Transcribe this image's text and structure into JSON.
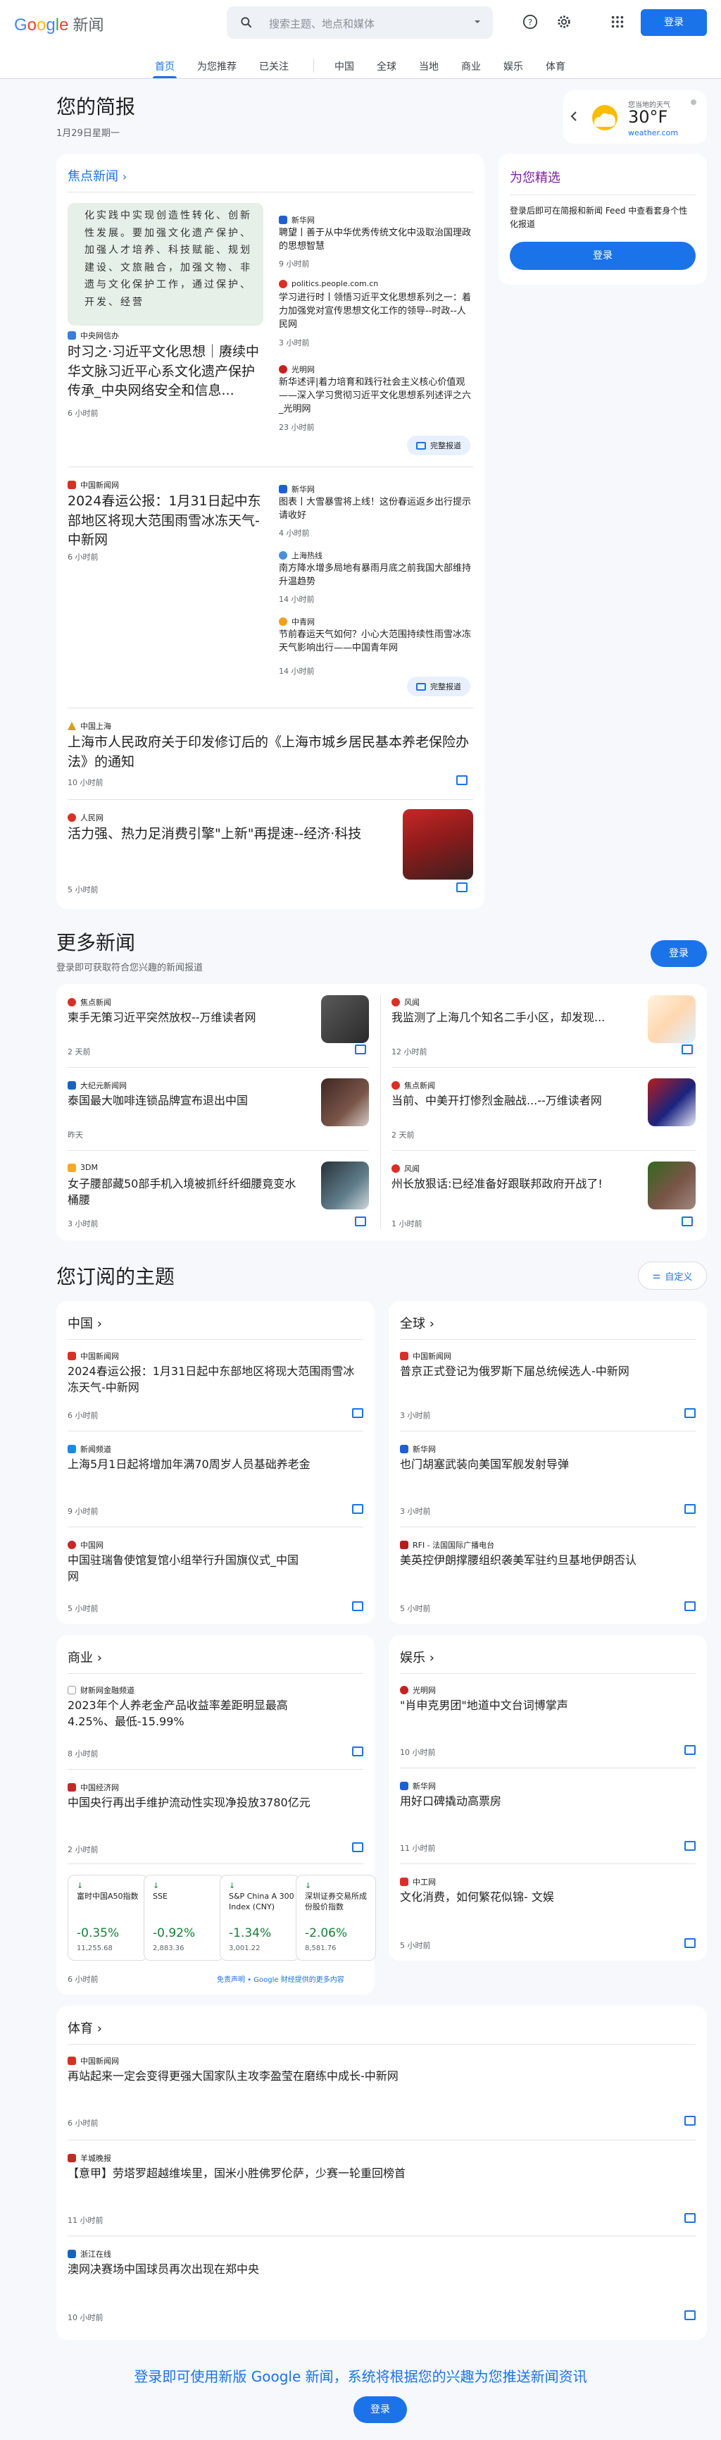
{
  "header": {
    "logo_google": "Google",
    "logo_news": "新闻",
    "search_placeholder": "搜索主题、地点和媒体",
    "signin": "登录"
  },
  "nav": {
    "items": [
      "首页",
      "为您推荐",
      "已关注",
      "中国",
      "全球",
      "当地",
      "商业",
      "娱乐",
      "体育"
    ]
  },
  "briefing": {
    "title": "您的简报",
    "date": "1月29日星期一"
  },
  "weather": {
    "label": "您当地的天气",
    "temp": "30°F",
    "source": "weather.com"
  },
  "foryou": {
    "title": "为您精选",
    "text": "登录后即可在简报和新闻 Feed 中查看套身个性化报道",
    "button": "登录"
  },
  "top": {
    "title": "焦点新闻",
    "c1": {
      "src": "中央网信办",
      "headline": "时习之·习近平文化思想｜赓续中华文脉习近平心系文化遗产保护传承_中央网络安全和信息...",
      "time": "6 小时前",
      "side": [
        {
          "src": "新华网",
          "t": "聘望丨善于从中华优秀传统文化中汲取治国理政的思想智慧",
          "tm": "9 小时前"
        },
        {
          "src": "politics.people.com.cn",
          "t": "学习进行时丨领悟习近平文化思想系列之一：着力加强党对宣传思想文化工作的领导--时政--人民网",
          "tm": "3 小时前"
        },
        {
          "src": "光明网",
          "t": "新华述评|着力培育和践行社会主义核心价值观——深入学习贯彻习近平文化思想系列述评之六_光明网",
          "tm": "23 小时前"
        }
      ],
      "full": "完整报道"
    },
    "c2": {
      "src": "中国新闻网",
      "headline": "2024春运公报：1月31日起中东部地区将现大范围雨雪冰冻天气-中新网",
      "time": "6 小时前",
      "side": [
        {
          "src": "新华网",
          "t": "图表丨大雪暴雪将上线！这份春运返乡出行提示请收好",
          "tm": "4 小时前"
        },
        {
          "src": "上海热线",
          "t": "南方降水增多局地有暴雨月底之前我国大部维持升温趋势",
          "tm": "14 小时前"
        },
        {
          "src": "中青网",
          "t": "节前春运天气如何？小心大范围持续性雨雪冰冻天气影响出行——中国青年网",
          "tm": "14 小时前"
        }
      ],
      "full": "完整报道"
    },
    "c3": {
      "src": "中国上海",
      "headline": "上海市人民政府关于印发修订后的《上海市城乡居民基本养老保险办法》的通知",
      "time": "10 小时前"
    },
    "c4": {
      "src": "人民网",
      "headline": "活力强、热力足消费引擎\"上新\"再提速--经济·科技",
      "time": "5 小时前"
    },
    "calligraphy": "化实践中实现创造性转化、创新性发展。要加强文化遗产保护、加强人才培养、科技赋能、规划建设、文旅融合，加强文物、非遗与文化保护工作，通过保护、开发、经营"
  },
  "more": {
    "title": "更多新闻",
    "sub": "登录即可获取符合您兴趣的新闻报道",
    "button": "登录",
    "items": [
      {
        "src": "焦点新闻",
        "t": "柬手无策习近平突然放权--万维读者网",
        "tm": "2 天前"
      },
      {
        "src": "风闻",
        "t": "我监测了上海几个知名二手小区，却发现...",
        "tm": "12 小时前"
      },
      {
        "src": "大纪元新闻网",
        "t": "泰国最大咖啡连锁品牌宣布退出中国",
        "tm": "昨天"
      },
      {
        "src": "焦点新闻",
        "t": "当前、中美开打惨烈金融战...--万维读者网",
        "tm": "2 天前"
      },
      {
        "src": "3DM",
        "t": "女子腰部藏50部手机入境被抓纤纤细腰竟变水桶腰",
        "tm": "3 小时前"
      },
      {
        "src": "风闻",
        "t": "州长放狠话:已经准备好跟联邦政府开战了!",
        "tm": "1 小时前"
      }
    ]
  },
  "topics": {
    "title": "您订阅的主题",
    "customize": "自定义",
    "china": {
      "title": "中国",
      "items": [
        {
          "src": "中国新闻网",
          "t": "2024春运公报：1月31日起中东部地区将现大范围雨雪冰冻天气-中新网",
          "tm": "6 小时前"
        },
        {
          "src": "新闻频道",
          "t": "上海5月1日起将增加年满70周岁人员基础养老金",
          "tm": "9 小时前"
        },
        {
          "src": "中国网",
          "t": "中国驻瑞鲁使馆复馆小组举行升国旗仪式_中国网",
          "tm": "5 小时前"
        }
      ]
    },
    "world": {
      "title": "全球",
      "items": [
        {
          "src": "中国新闻网",
          "t": "普京正式登记为俄罗斯下届总统候选人-中新网",
          "tm": "3 小时前"
        },
        {
          "src": "新华网",
          "t": "也门胡塞武装向美国军舰发射导弹",
          "tm": "3 小时前"
        },
        {
          "src": "RFI - 法国国际广播电台",
          "t": "美英控伊朗撑腰组织袭美军驻约旦基地伊朗否认",
          "tm": "5 小时前"
        }
      ]
    },
    "biz": {
      "title": "商业",
      "items": [
        {
          "src": "财新网金融频道",
          "t": "2023年个人养老金产品收益率差距明显最高4.25%、最低-15.99%",
          "tm": "8 小时前"
        },
        {
          "src": "中国经济网",
          "t": "中国央行再出手维护流动性实现净投放3780亿元",
          "tm": "2 小时前"
        }
      ],
      "markets": [
        {
          "n": "富时中国A50指数",
          "p": "-0.35%",
          "v": "11,255.68"
        },
        {
          "n": "SSE",
          "p": "-0.92%",
          "v": "2,883.36"
        },
        {
          "n": "S&P China A 300 Index (CNY)",
          "p": "-1.34%",
          "v": "3,001.22"
        },
        {
          "n": "深圳证券交易所成份股价指数",
          "p": "-2.06%",
          "v": "8,581.76"
        }
      ],
      "mtime": "6 小时前",
      "disclaimer": "免责声明 • Google 财经提供的更多内容"
    },
    "ent": {
      "title": "娱乐",
      "items": [
        {
          "src": "光明网",
          "t": "\"肖申克男团\"地道中文台词博掌声",
          "tm": "10 小时前"
        },
        {
          "src": "新华网",
          "t": "用好口碑撬动高票房",
          "tm": "11 小时前"
        },
        {
          "src": "中工网",
          "t": "文化消费，如何繁花似锦- 文娱",
          "tm": "5 小时前"
        }
      ]
    },
    "sport": {
      "title": "体育",
      "items": [
        {
          "src": "中国新闻网",
          "t": "再站起来一定会变得更强大国家队主攻李盈莹在磨练中成长-中新网",
          "tm": "6 小时前"
        },
        {
          "src": "羊城晚报",
          "t": "【意甲】劳塔罗超越维埃里，国米小胜佛罗伦萨，少赛一轮重回榜首",
          "tm": "11 小时前"
        },
        {
          "src": "浙江在线",
          "t": "澳网决赛场中国球员再次出现在郑中央",
          "tm": "10 小时前"
        }
      ]
    }
  },
  "footer": {
    "text": "登录即可使用新版 Google 新闻，系统将根据您的兴趣为您推送新闻资讯",
    "button": "登录"
  }
}
